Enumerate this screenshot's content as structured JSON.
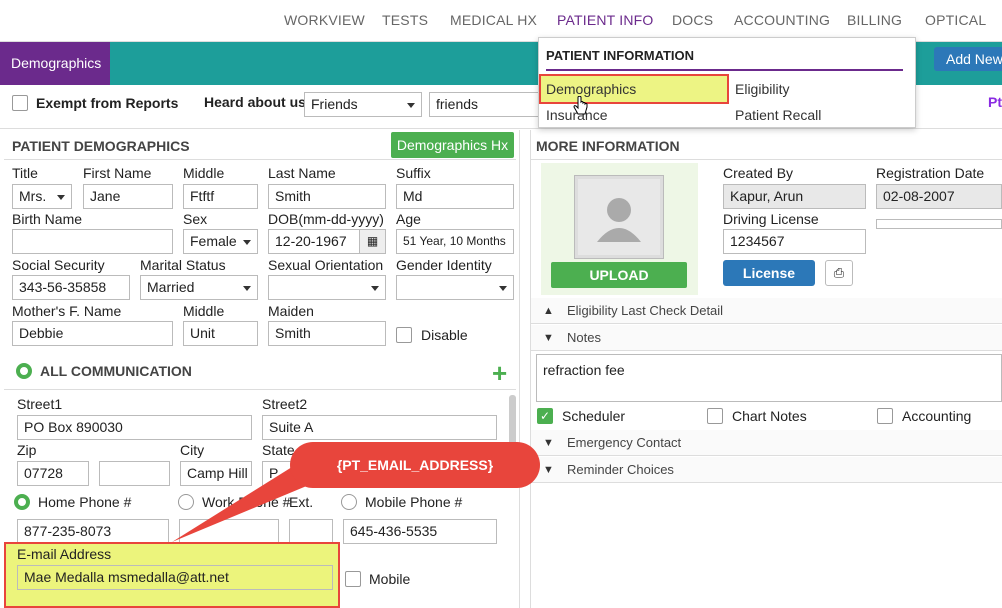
{
  "nav": {
    "items": [
      "WORKVIEW",
      "TESTS",
      "MEDICAL HX",
      "PATIENT INFO",
      "DOCS",
      "ACCOUNTING",
      "BILLING",
      "OPTICAL"
    ],
    "active": "PATIENT INFO"
  },
  "header": {
    "tab": "Demographics",
    "add_new": "Add New",
    "partial_right": "Pt"
  },
  "options": {
    "exempt_label": "Exempt from Reports",
    "heard_label": "Heard about us",
    "heard_value": "Friends",
    "heard_detail": "friends"
  },
  "dropdown": {
    "title": "PATIENT INFORMATION",
    "items": [
      "Demographics",
      "Eligibility",
      "Insurance",
      "Patient Recall"
    ]
  },
  "patient": {
    "section_title": "PATIENT DEMOGRAPHICS",
    "hx_button": "Demographics Hx",
    "labels": {
      "title": "Title",
      "first": "First Name",
      "middle": "Middle",
      "last": "Last Name",
      "suffix": "Suffix",
      "birth_name": "Birth Name",
      "sex": "Sex",
      "dob": "DOB(mm-dd-yyyy)",
      "age": "Age",
      "ssn": "Social Security",
      "marital": "Marital Status",
      "orientation": "Sexual Orientation",
      "gender": "Gender Identity",
      "mother": "Mother's F. Name",
      "mother_middle": "Middle",
      "maiden": "Maiden",
      "disable": "Disable"
    },
    "values": {
      "title": "Mrs.",
      "first": "Jane",
      "middle": "Ftftf",
      "last": "Smith",
      "suffix": "Md",
      "birth_name": "",
      "sex": "Female",
      "dob": "12-20-1967",
      "age": "51 Year, 10 Months",
      "ssn": "343-56-35858",
      "marital": "Married",
      "orientation": "",
      "gender": "",
      "mother": "Debbie",
      "mother_middle": "Unit",
      "maiden": "Smith"
    }
  },
  "communication": {
    "title": "ALL COMMUNICATION",
    "labels": {
      "street1": "Street1",
      "street2": "Street2",
      "zip": "Zip",
      "city": "City",
      "state": "State",
      "home_phone": "Home Phone #",
      "work_phone": "Work Phone #",
      "ext": "Ext.",
      "mobile_phone": "Mobile Phone #",
      "email": "E-mail Address",
      "mobile": "Mobile"
    },
    "values": {
      "street1": "PO Box 890030",
      "street2": "Suite A",
      "zip": "07728",
      "zip_ext": "",
      "city": "Camp Hill",
      "state": "P",
      "home_phone": "877-235-8073",
      "work_phone": "",
      "ext": "",
      "mobile_phone": "645-436-5535",
      "email": "Mae Medalla  msmedalla@att.net"
    }
  },
  "more_info": {
    "title": "MORE INFORMATION",
    "upload": "UPLOAD",
    "created_by_label": "Created By",
    "created_by": "Kapur, Arun",
    "reg_date_label": "Registration Date",
    "reg_date": "02-08-2007",
    "license_label": "Driving License",
    "license_value": "1234567",
    "license_button": "License"
  },
  "accordions": {
    "eligibility": "Eligibility Last Check Detail",
    "notes": "Notes",
    "notes_text": "refraction fee",
    "scheduler": "Scheduler",
    "chart_notes": "Chart Notes",
    "accounting": "Accounting",
    "emergency": "Emergency Contact",
    "reminder": "Reminder Choices"
  },
  "callout": {
    "text": "{PT_EMAIL_ADDRESS}"
  }
}
